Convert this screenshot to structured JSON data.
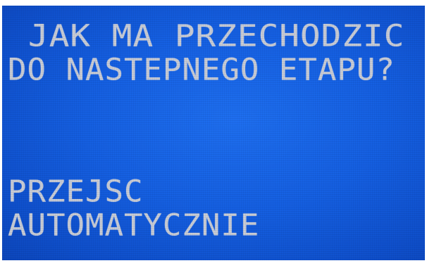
{
  "screen": {
    "question_line1": "JAK MA PRZECHODZIC",
    "question_line2": "DO NASTEPNEGO ETAPU?",
    "option_line1": "PRZEJSC",
    "option_line2": "AUTOMATYCZNIE"
  },
  "colors": {
    "background": "#1560e2",
    "text": "#c9cdd6",
    "frame": "#ffffff"
  }
}
